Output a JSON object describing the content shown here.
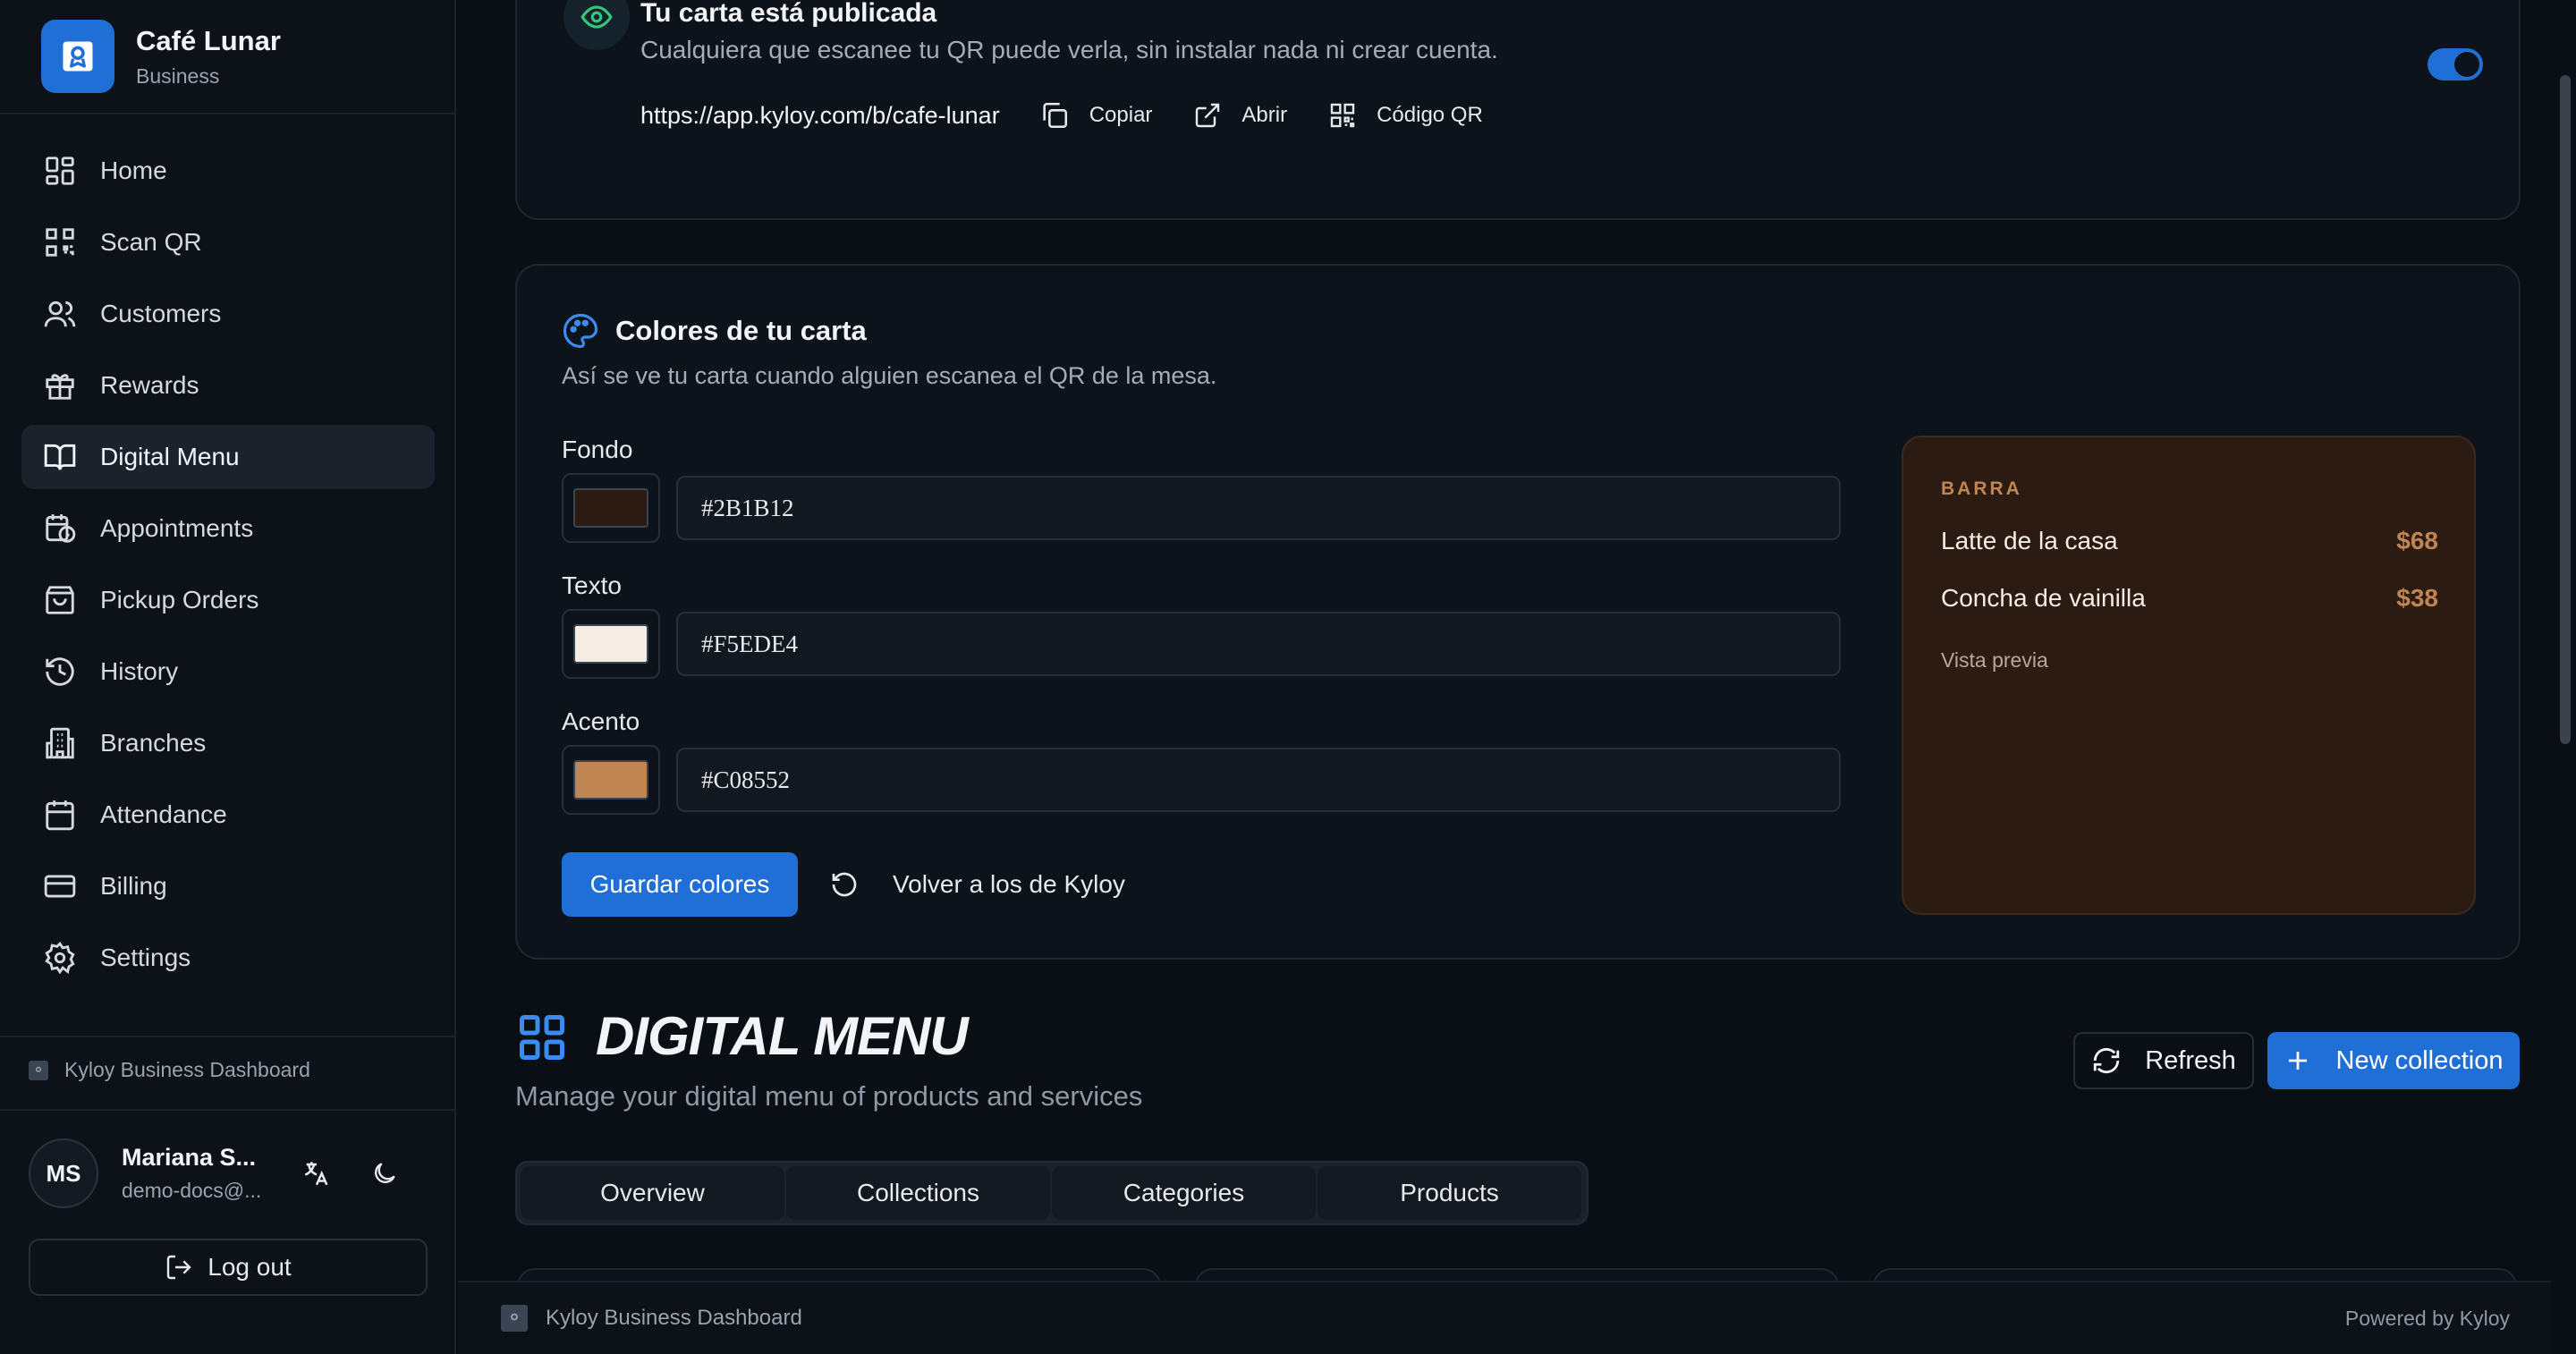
{
  "brand": {
    "name": "Café Lunar",
    "subtitle": "Business"
  },
  "nav": [
    {
      "label": "Home",
      "icon": "home-grid-icon"
    },
    {
      "label": "Scan QR",
      "icon": "qr-scan-icon"
    },
    {
      "label": "Customers",
      "icon": "users-icon"
    },
    {
      "label": "Rewards",
      "icon": "gift-icon"
    },
    {
      "label": "Digital Menu",
      "icon": "book-open-icon",
      "active": true
    },
    {
      "label": "Appointments",
      "icon": "calendar-clock-icon"
    },
    {
      "label": "Pickup Orders",
      "icon": "shopping-bag-icon"
    },
    {
      "label": "History",
      "icon": "history-icon"
    },
    {
      "label": "Branches",
      "icon": "building-icon"
    },
    {
      "label": "Attendance",
      "icon": "calendar-icon"
    },
    {
      "label": "Billing",
      "icon": "credit-card-icon"
    },
    {
      "label": "Settings",
      "icon": "gear-icon"
    }
  ],
  "sidebar_footer": {
    "label": "Kyloy Business Dashboard"
  },
  "user": {
    "initials": "MS",
    "name": "Mariana S...",
    "email": "demo-docs@...",
    "logout_label": "Log out"
  },
  "published": {
    "title": "Tu carta está publicada",
    "description": "Cualquiera que escanee tu QR puede verla, sin instalar nada ni crear cuenta.",
    "url": "https://app.kyloy.com/b/cafe-lunar",
    "copy_label": "Copiar",
    "open_label": "Abrir",
    "qr_label": "Código QR",
    "toggle_on": true
  },
  "colors": {
    "title": "Colores de tu carta",
    "description": "Así se ve tu carta cuando alguien escanea el QR de la mesa.",
    "fields": [
      {
        "label": "Fondo",
        "value": "#2B1B12"
      },
      {
        "label": "Texto",
        "value": "#F5EDE4"
      },
      {
        "label": "Acento",
        "value": "#C08552"
      }
    ],
    "save_label": "Guardar colores",
    "reset_label": "Volver a los de Kyloy",
    "preview": {
      "section": "BARRA",
      "items": [
        {
          "name": "Latte de la casa",
          "price": "$68"
        },
        {
          "name": "Concha de vainilla",
          "price": "$38"
        }
      ],
      "note": "Vista previa"
    }
  },
  "digital_menu": {
    "title": "DIGITAL MENU",
    "subtitle": "Manage your digital menu of products and services",
    "refresh_label": "Refresh",
    "new_label": "New collection",
    "tabs": [
      "Overview",
      "Collections",
      "Categories",
      "Products"
    ]
  },
  "footer": {
    "left": "Kyloy Business Dashboard",
    "right": "Powered by Kyloy"
  },
  "theme": {
    "accent": "#1f6fd6",
    "background": "#0a0f16",
    "card": "#0d131b"
  }
}
